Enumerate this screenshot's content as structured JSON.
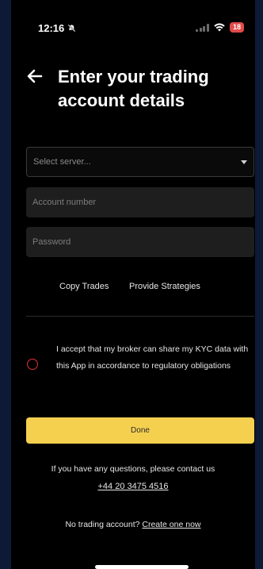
{
  "status_bar": {
    "time": "12:16",
    "battery": "18",
    "icons": [
      "bell-slash-icon",
      "signal-icon",
      "wifi-icon",
      "battery-icon"
    ]
  },
  "header": {
    "title": "Enter your trading account details",
    "back_icon": "arrow-left-icon"
  },
  "form": {
    "server_placeholder": "Select server...",
    "account_placeholder": "Account number",
    "password_placeholder": "Password"
  },
  "links": {
    "copy_trades": "Copy Trades",
    "provide_strategies": "Provide Strategies"
  },
  "consent": {
    "text": "I accept that my broker can share my KYC data with this App in accordance to regulatory obligations"
  },
  "done_label": "Done",
  "contact": {
    "text": "If you have any questions, please contact us",
    "phone": "+44 20 3475 4516"
  },
  "no_account": {
    "text": "No trading account?",
    "link": "Create one now"
  },
  "colors": {
    "accent": "#f5d04f",
    "radio": "#e2303a",
    "background": "#000000",
    "frame": "#0d1a35"
  }
}
